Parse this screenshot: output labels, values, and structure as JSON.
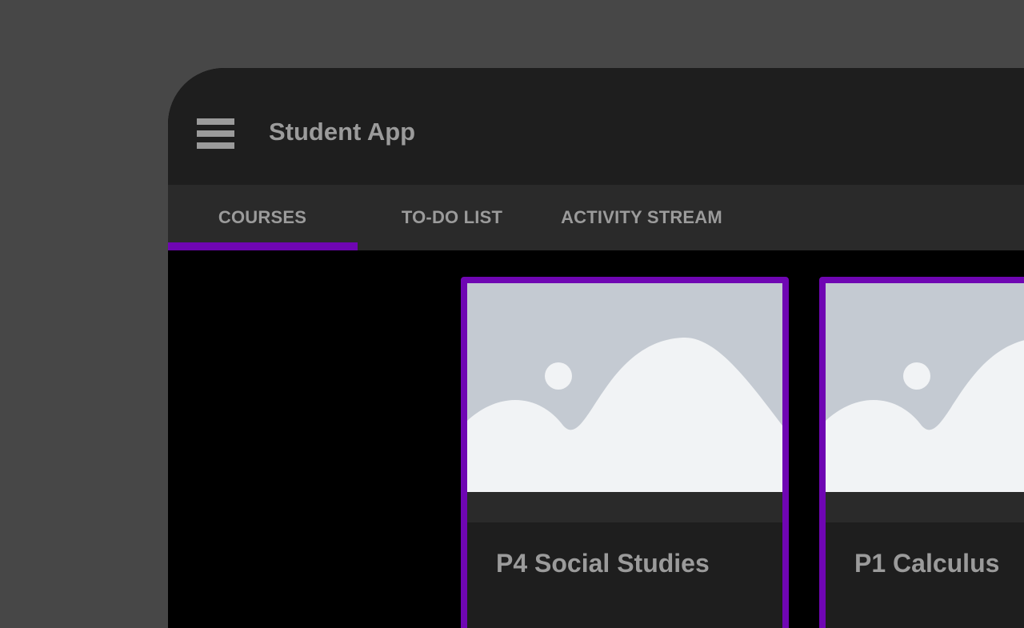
{
  "app": {
    "title": "Student App"
  },
  "icons": {
    "menu": "hamburger-menu-icon",
    "card_image": "image-placeholder-icon"
  },
  "tabs": [
    {
      "label": "COURSES",
      "selected": true
    },
    {
      "label": "TO-DO LIST",
      "selected": false
    },
    {
      "label": "ACTIVITY STREAM",
      "selected": false
    }
  ],
  "courses": [
    {
      "title": "P4 Social Studies"
    },
    {
      "title": "P1 Calculus"
    }
  ],
  "colors": {
    "background": "#474747",
    "app_bar": "#1e1e1e",
    "tab_bar": "#2a2a2a",
    "content": "#000000",
    "accent": "#6f06b3",
    "text": "#9b9b9b",
    "placeholder_back": "#c4cad2",
    "placeholder_front": "#f1f3f5"
  }
}
